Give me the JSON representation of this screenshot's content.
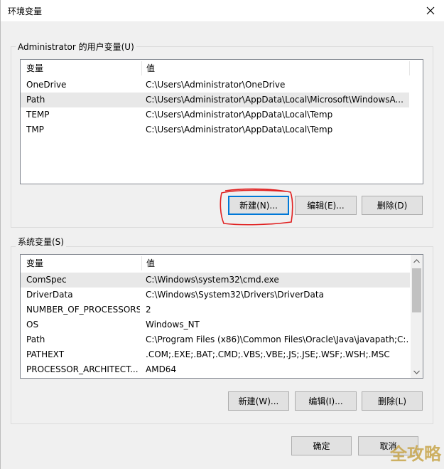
{
  "window": {
    "title": "环境变量"
  },
  "user_vars": {
    "label": "Administrator 的用户变量(U)",
    "headers": {
      "name": "变量",
      "value": "值"
    },
    "rows": [
      {
        "name": "OneDrive",
        "value": "C:\\Users\\Administrator\\OneDrive"
      },
      {
        "name": "Path",
        "value": "C:\\Users\\Administrator\\AppData\\Local\\Microsoft\\WindowsA..."
      },
      {
        "name": "TEMP",
        "value": "C:\\Users\\Administrator\\AppData\\Local\\Temp"
      },
      {
        "name": "TMP",
        "value": "C:\\Users\\Administrator\\AppData\\Local\\Temp"
      }
    ],
    "buttons": {
      "new": "新建(N)...",
      "edit": "编辑(E)...",
      "delete": "删除(D)"
    }
  },
  "system_vars": {
    "label": "系统变量(S)",
    "headers": {
      "name": "变量",
      "value": "值"
    },
    "rows": [
      {
        "name": "ComSpec",
        "value": "C:\\Windows\\system32\\cmd.exe"
      },
      {
        "name": "DriverData",
        "value": "C:\\Windows\\System32\\Drivers\\DriverData"
      },
      {
        "name": "NUMBER_OF_PROCESSORS",
        "value": "2"
      },
      {
        "name": "OS",
        "value": "Windows_NT"
      },
      {
        "name": "Path",
        "value": "C:\\Program Files (x86)\\Common Files\\Oracle\\Java\\javapath;C:..."
      },
      {
        "name": "PATHEXT",
        "value": ".COM;.EXE;.BAT;.CMD;.VBS;.VBE;.JS;.JSE;.WSF;.WSH;.MSC"
      },
      {
        "name": "PROCESSOR_ARCHITECT...",
        "value": "AMD64"
      }
    ],
    "buttons": {
      "new": "新建(W)...",
      "edit": "编辑(I)...",
      "delete": "删除(L)"
    }
  },
  "footer": {
    "ok": "确定",
    "cancel": "取消"
  },
  "watermark": "全攻略",
  "colors": {
    "focus_border": "#0078d7",
    "highlight_annotation": "#e02020",
    "watermark": "#c8a54a"
  },
  "icons": {
    "close": "close-icon",
    "scroll_up": "chevron-up-icon",
    "scroll_down": "chevron-down-icon"
  }
}
